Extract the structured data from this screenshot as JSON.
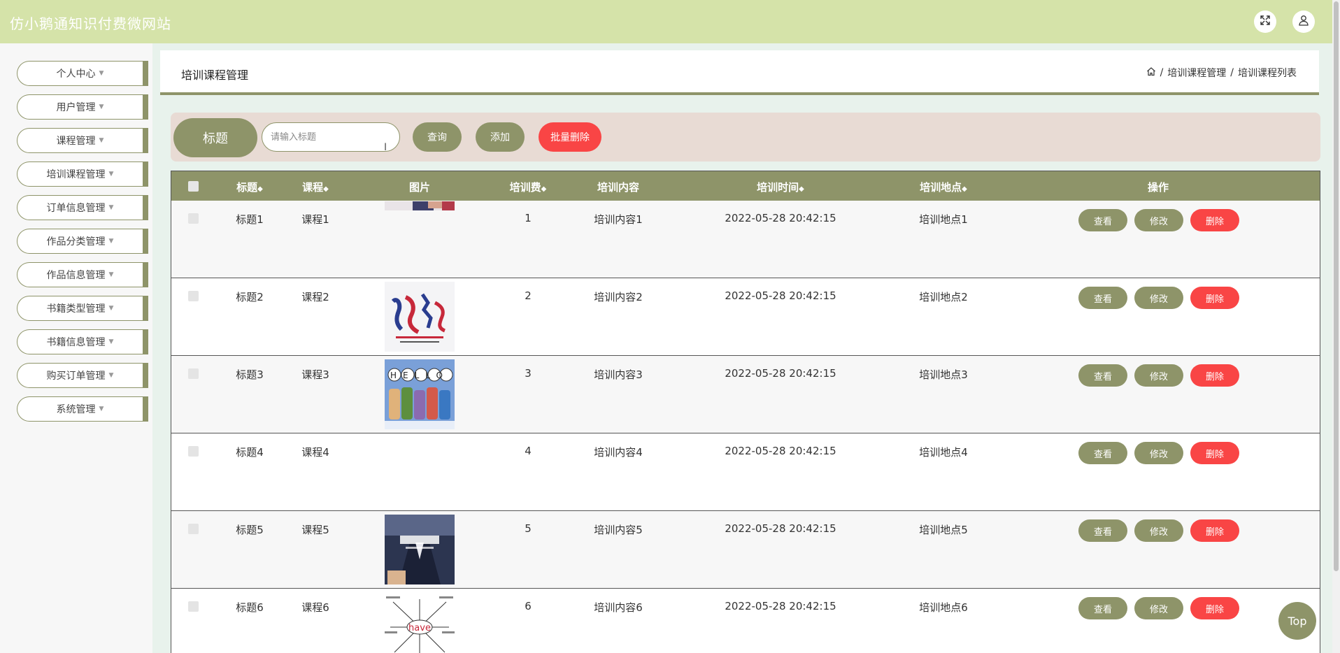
{
  "app": {
    "title": "仿小鹅通知识付费微网站"
  },
  "sidebar": {
    "items": [
      {
        "label": "个人中心"
      },
      {
        "label": "用户管理"
      },
      {
        "label": "课程管理"
      },
      {
        "label": "培训课程管理"
      },
      {
        "label": "订单信息管理"
      },
      {
        "label": "作品分类管理"
      },
      {
        "label": "作品信息管理"
      },
      {
        "label": "书籍类型管理"
      },
      {
        "label": "书籍信息管理"
      },
      {
        "label": "购买订单管理"
      },
      {
        "label": "系统管理"
      }
    ]
  },
  "header": {
    "page_title": "培训课程管理",
    "breadcrumb": [
      "培训课程管理",
      "培训课程列表"
    ],
    "separator": "/"
  },
  "search": {
    "label": "标题",
    "placeholder": "请输入标题",
    "query_label": "查询",
    "add_label": "添加",
    "batch_delete_label": "批量删除"
  },
  "table": {
    "columns": [
      "标题",
      "课程",
      "图片",
      "培训费",
      "培训内容",
      "培训时间",
      "培训地点",
      "操作"
    ],
    "sort_icon": "◆",
    "rows": [
      {
        "title": "标题1",
        "course": "课程1",
        "image": "portrait-top",
        "fee": "1",
        "content": "培训内容1",
        "time": "2022-05-28 20:42:15",
        "place": "培训地点1"
      },
      {
        "title": "标题2",
        "course": "课程2",
        "image": "calligraphy-poster",
        "fee": "2",
        "content": "培训内容2",
        "time": "2022-05-28 20:42:15",
        "place": "培训地点2"
      },
      {
        "title": "标题3",
        "course": "课程3",
        "image": "hello-cartoon",
        "fee": "3",
        "content": "培训内容3",
        "time": "2022-05-28 20:42:15",
        "place": "培训地点3"
      },
      {
        "title": "标题4",
        "course": "课程4",
        "image": "blank-strip",
        "fee": "4",
        "content": "培训内容4",
        "time": "2022-05-28 20:42:15",
        "place": "培训地点4"
      },
      {
        "title": "标题5",
        "course": "课程5",
        "image": "business-suit",
        "fee": "5",
        "content": "培训内容5",
        "time": "2022-05-28 20:42:15",
        "place": "培训地点5"
      },
      {
        "title": "标题6",
        "course": "课程6",
        "image": "have-mindmap",
        "fee": "6",
        "content": "培训内容6",
        "time": "2022-05-28 20:42:15",
        "place": "培训地点6"
      }
    ],
    "actions": {
      "view": "查看",
      "edit": "修改",
      "delete": "删除"
    }
  },
  "top_button": {
    "label": "Top"
  },
  "thumbnail_text": {
    "have": "have",
    "hello": "HELLO"
  },
  "colors": {
    "accent": "#8e9469",
    "danger": "#f94545",
    "topbar": "#d5e3a9",
    "search_bg": "#e8dbd4"
  },
  "icons": [
    "fullscreen-icon",
    "user-icon",
    "home-icon",
    "sort-icon",
    "text-cursor-icon"
  ]
}
